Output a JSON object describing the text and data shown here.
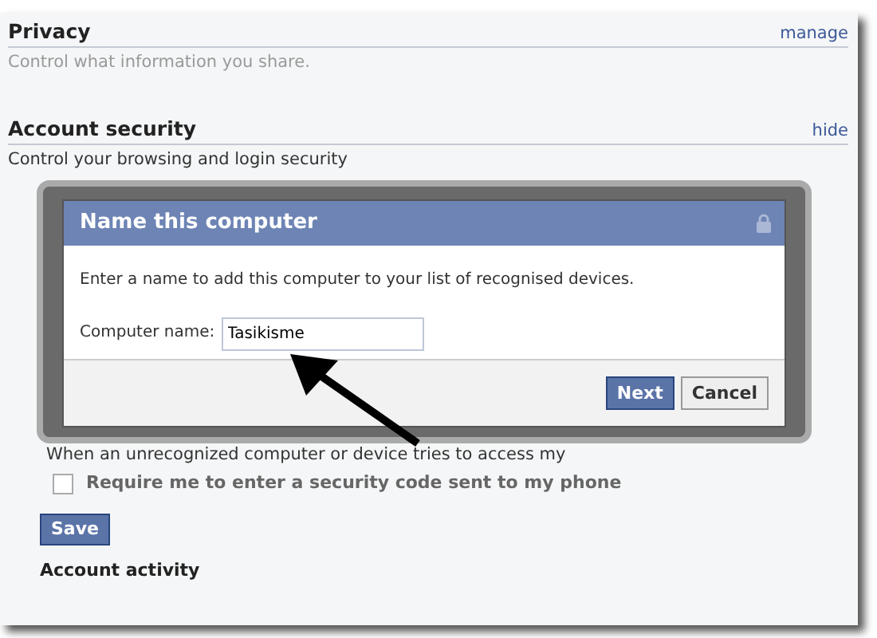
{
  "sections": [
    {
      "title": "Privacy",
      "action": "manage",
      "description": "Control what information you share.",
      "muted": true
    },
    {
      "title": "Account security",
      "action": "hide",
      "description": "Control your browsing and login security",
      "muted": false
    }
  ],
  "notice": "When an unrecognized computer or device tries to access my",
  "option": {
    "label": "Require me to enter a security code sent to my phone",
    "checked": false
  },
  "save_button": "Save",
  "next_section": "Account activity",
  "dialog": {
    "title": "Name this computer",
    "message": "Enter a name to add this computer to your list of recognised devices.",
    "field_label": "Computer name:",
    "field_value": "Tasikisme",
    "buttons": [
      {
        "label": "Next",
        "kind": "primary"
      },
      {
        "label": "Cancel",
        "kind": "secondary"
      }
    ]
  }
}
